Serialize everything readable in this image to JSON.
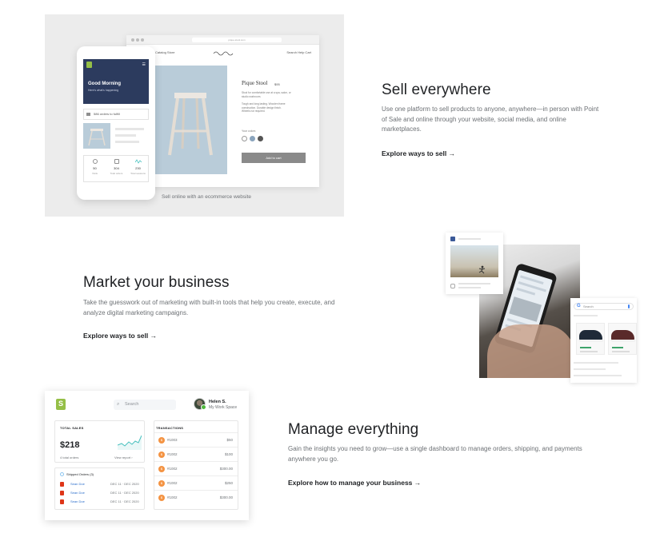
{
  "sections": {
    "sell": {
      "title": "Sell everywhere",
      "description": "Use one platform to sell products to anyone, anywhere—in person with Point of Sale and online through your website, social media, and online marketplaces.",
      "link_label": "Explore ways to sell",
      "link_arrow": "→"
    },
    "market": {
      "title": "Market your business",
      "description": "Take the guesswork out of marketing with built-in tools that help you create, execute, and analyze digital marketing campaigns.",
      "link_label": "Explore ways to sell",
      "link_arrow": "→"
    },
    "manage": {
      "title": "Manage everything",
      "description": "Gain the insights you need to grow—use a single dashboard to manage orders, shipping, and payments anywhere you go.",
      "link_label": "Explore how to manage your business",
      "link_arrow": "→"
    }
  },
  "storefront": {
    "caption": "Sell online with an ecommerce website",
    "url": "pique-stool.com",
    "nav_left": "Catalog  Store",
    "nav_right": "Search   Help   Cart",
    "product_title": "Pique Stool",
    "product_price": "$95",
    "product_desc": "Stool for comfortable use at a spa, salon, or studio workroom.",
    "product_details": "Tough and long lasting. Wooden frame construction. Durable design finish. Wheels not required.",
    "color_label": "Your colors",
    "add_to_cart": "Add to cart",
    "swatch_colors": [
      "#ffffff",
      "#8aa4bd",
      "#555555"
    ]
  },
  "mobile_app": {
    "greeting": "Good Morning",
    "greeting_sub": "Here's what's happening",
    "orders_label": "586 orders to fulfill",
    "stats": [
      {
        "value": "50",
        "label": "Visits"
      },
      {
        "value": "304",
        "label": "Total orders"
      },
      {
        "value": "230",
        "label": "Total sessions"
      }
    ],
    "menu_icon": "☰"
  },
  "google_card": {
    "logo": "G",
    "search_placeholder": "Search"
  },
  "dashboard": {
    "search_placeholder": "Search",
    "search_icon": "magnifier-icon",
    "user_name": "Helen S.",
    "workspace": "My Work Space",
    "total_sales_label": "TOTAL SALES",
    "total_sales_value": "$218",
    "total_orders_label": "4 total orders",
    "view_report": "View report ›",
    "orders_title": "Shipped Orders (3)",
    "orders": [
      {
        "name": "Sean Doe",
        "date": "DEC 11 · DEC 2020"
      },
      {
        "name": "Sean Doe",
        "date": "DEC 11 · DEC 2020"
      },
      {
        "name": "Sean Doe",
        "date": "DEC 11 · DEC 2020"
      }
    ],
    "transactions_label": "TRANSACTIONS",
    "transactions": [
      {
        "icon": "$",
        "id": "#1003",
        "amount": "$50"
      },
      {
        "icon": "$",
        "id": "#1002",
        "amount": "$100"
      },
      {
        "icon": "$",
        "id": "#1002",
        "amount": "$300.00"
      },
      {
        "icon": "$",
        "id": "#1002",
        "amount": "$250"
      },
      {
        "icon": "$",
        "id": "#1002",
        "amount": "$300.00"
      }
    ],
    "accent_green": "#95bf47",
    "sparkline_color": "#47c1bf"
  }
}
